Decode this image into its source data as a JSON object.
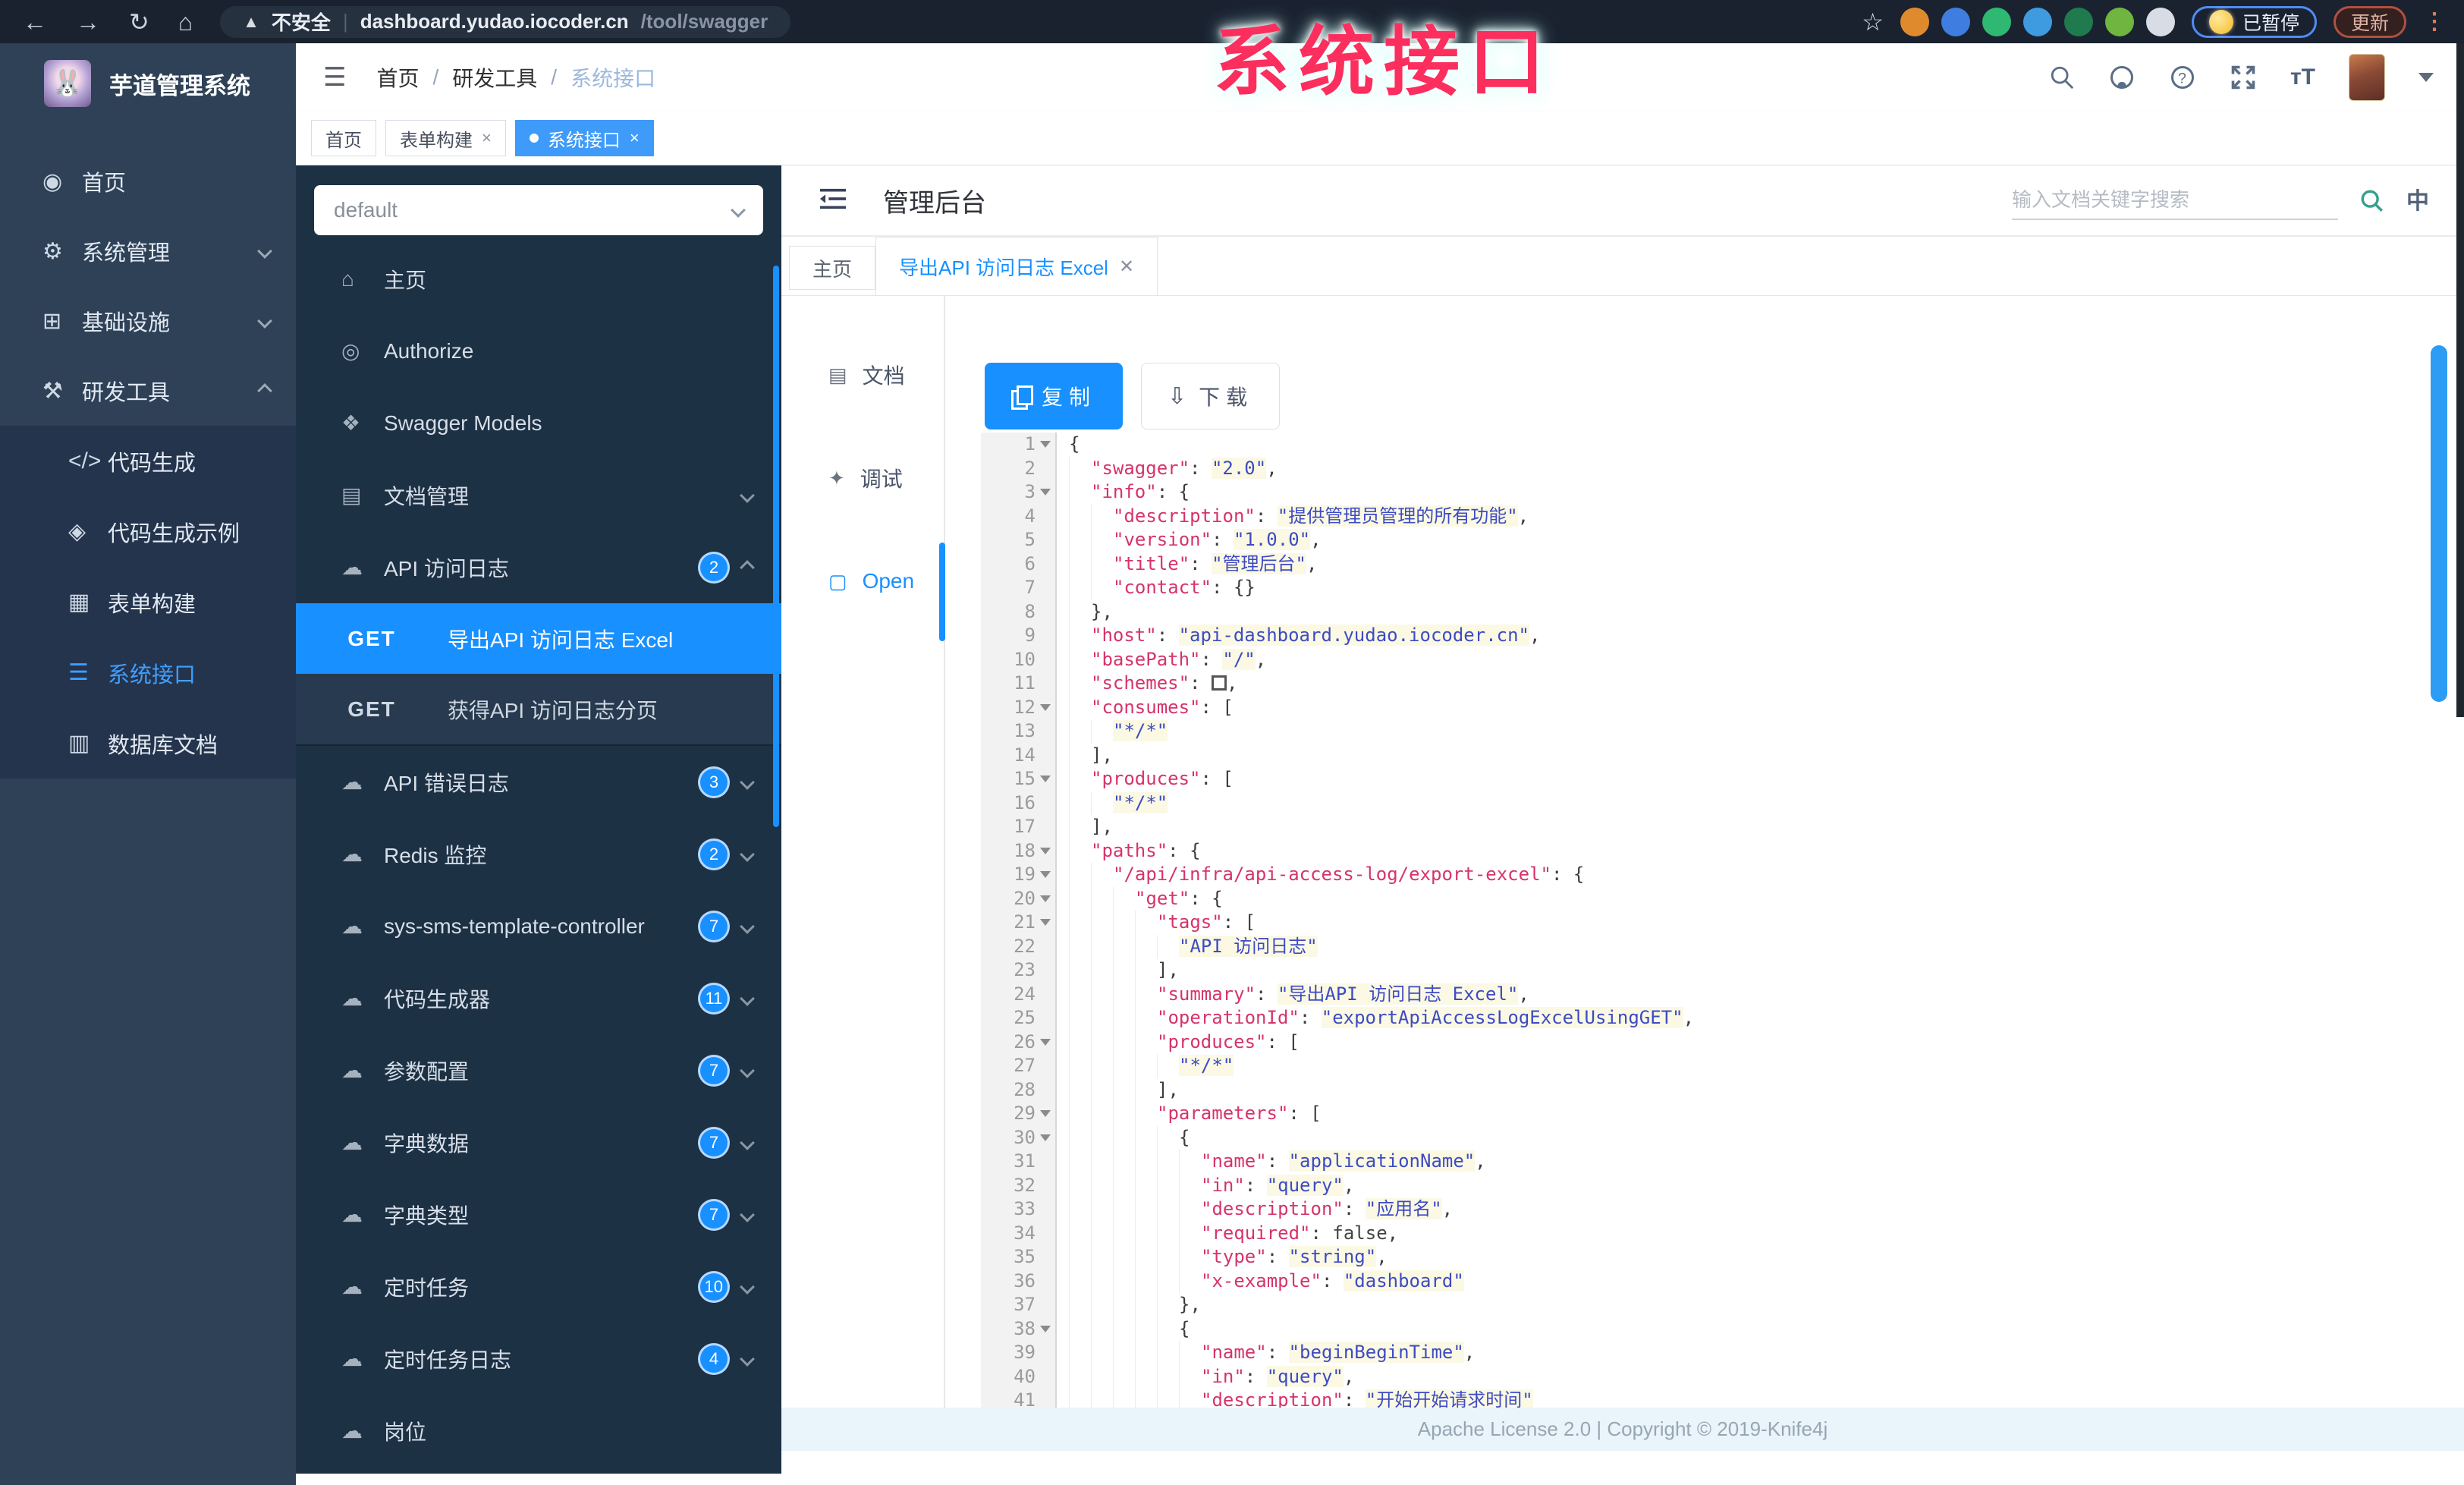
{
  "browser": {
    "back_icon": "←",
    "forward_icon": "→",
    "reload_icon": "↻",
    "home_icon": "⌂",
    "warning_icon": "▲",
    "security_label": "不安全",
    "url_host": "dashboard.yudao.iocoder.cn",
    "url_path": "/tool/swagger",
    "star_icon": "☆",
    "paused_label": "已暂停",
    "update_label": "更新",
    "menu_icon": "⋮",
    "extension_colors": [
      "#e08a2e",
      "#3f7de0",
      "#2eb872",
      "#3f9be0",
      "#1f7a4d",
      "#6fb53f",
      "#d8dde5"
    ]
  },
  "watermark": "系统接口",
  "sidebar": {
    "logo_title": "芋道管理系统",
    "logo_glyph": "🐰",
    "items": [
      {
        "id": "home",
        "icon": "dashboard-icon",
        "glyph": "◉",
        "label": "首页",
        "chevron": ""
      },
      {
        "id": "system",
        "icon": "gear-icon",
        "glyph": "⚙",
        "label": "系统管理",
        "chevron": "down"
      },
      {
        "id": "infra",
        "icon": "infra-icon",
        "glyph": "⊞",
        "label": "基础设施",
        "chevron": "down"
      },
      {
        "id": "devtools",
        "icon": "toolbox-icon",
        "glyph": "⚒",
        "label": "研发工具",
        "chevron": "up"
      }
    ],
    "sub_items": [
      {
        "id": "codegen",
        "icon": "code-icon",
        "glyph": "</>",
        "label": "代码生成",
        "active": false
      },
      {
        "id": "codegen-demo",
        "icon": "shield-check-icon",
        "glyph": "◈",
        "label": "代码生成示例",
        "active": false
      },
      {
        "id": "form-builder",
        "icon": "form-icon",
        "glyph": "▦",
        "label": "表单构建",
        "active": false
      },
      {
        "id": "system-api",
        "icon": "list-icon",
        "glyph": "☰",
        "label": "系统接口",
        "active": true
      },
      {
        "id": "db-doc",
        "icon": "table-icon",
        "glyph": "▥",
        "label": "数据库文档",
        "active": false
      }
    ]
  },
  "header": {
    "hamburger_icon": "☰",
    "breadcrumb": [
      "首页",
      "研发工具",
      "系统接口"
    ],
    "text_size_label": "тT"
  },
  "tags": [
    {
      "label": "首页",
      "closable": false,
      "active": false
    },
    {
      "label": "表单构建",
      "closable": true,
      "active": false
    },
    {
      "label": "系统接口",
      "closable": true,
      "active": true
    }
  ],
  "swagger_sidebar": {
    "group_select_value": "default",
    "items": [
      {
        "icon": "home-icon",
        "glyph": "⌂",
        "label": "主页",
        "badge": "",
        "chevron": ""
      },
      {
        "icon": "lock-icon",
        "glyph": "◎",
        "label": "Authorize",
        "badge": "",
        "chevron": ""
      },
      {
        "icon": "models-icon",
        "glyph": "❖",
        "label": "Swagger Models",
        "badge": "",
        "chevron": ""
      },
      {
        "icon": "doc-manage-icon",
        "glyph": "▤",
        "label": "文档管理",
        "badge": "",
        "chevron": "down"
      },
      {
        "icon": "api-cloud-icon",
        "glyph": "☁",
        "label": "API 访问日志",
        "badge": "2",
        "chevron": "up"
      }
    ],
    "get_items": [
      {
        "method": "GET",
        "label": "导出API 访问日志 Excel",
        "active": true
      },
      {
        "method": "GET",
        "label": "获得API 访问日志分页",
        "active": false
      }
    ],
    "items_after": [
      {
        "icon": "api-cloud-icon",
        "glyph": "☁",
        "label": "API 错误日志",
        "badge": "3",
        "chevron": "down"
      },
      {
        "icon": "api-cloud-icon",
        "glyph": "☁",
        "label": "Redis 监控",
        "badge": "2",
        "chevron": "down"
      },
      {
        "icon": "api-cloud-icon",
        "glyph": "☁",
        "label": "sys-sms-template-controller",
        "badge": "7",
        "chevron": "down"
      },
      {
        "icon": "api-cloud-icon",
        "glyph": "☁",
        "label": "代码生成器",
        "badge": "11",
        "chevron": "down"
      },
      {
        "icon": "api-cloud-icon",
        "glyph": "☁",
        "label": "参数配置",
        "badge": "7",
        "chevron": "down"
      },
      {
        "icon": "api-cloud-icon",
        "glyph": "☁",
        "label": "字典数据",
        "badge": "7",
        "chevron": "down"
      },
      {
        "icon": "api-cloud-icon",
        "glyph": "☁",
        "label": "字典类型",
        "badge": "7",
        "chevron": "down"
      },
      {
        "icon": "api-cloud-icon",
        "glyph": "☁",
        "label": "定时任务",
        "badge": "10",
        "chevron": "down"
      },
      {
        "icon": "api-cloud-icon",
        "glyph": "☁",
        "label": "定时任务日志",
        "badge": "4",
        "chevron": "down"
      },
      {
        "icon": "api-cloud-icon",
        "glyph": "☁",
        "label": "岗位",
        "badge": "",
        "chevron": ""
      }
    ]
  },
  "doc": {
    "title": "管理后台",
    "search_placeholder": "输入文档关键字搜索",
    "lang_label": "中",
    "tabs": [
      {
        "label": "主页",
        "closable": false,
        "active": false
      },
      {
        "label": "导出API 访问日志 Excel",
        "closable": true,
        "active": true
      }
    ],
    "rail": [
      {
        "icon": "document-icon",
        "glyph": "▤",
        "label": "文档",
        "active": false
      },
      {
        "icon": "debug-bug-icon",
        "glyph": "✦",
        "label": "调试",
        "active": false
      },
      {
        "icon": "open-file-icon",
        "glyph": "▢",
        "label": "Open",
        "active": true
      }
    ],
    "copy_label": "复制",
    "download_label": "下载",
    "download_icon": "⇩"
  },
  "code": {
    "lines": [
      {
        "n": 1,
        "ind": 0,
        "fold": true,
        "raw": "{"
      },
      {
        "n": 2,
        "ind": 1,
        "k": "swagger",
        "v": "2.0",
        "c": true
      },
      {
        "n": 3,
        "ind": 1,
        "fold": true,
        "k": "info",
        "open": "{"
      },
      {
        "n": 4,
        "ind": 2,
        "k": "description",
        "v": "提供管理员管理的所有功能",
        "c": true
      },
      {
        "n": 5,
        "ind": 2,
        "k": "version",
        "v": "1.0.0",
        "c": true
      },
      {
        "n": 6,
        "ind": 2,
        "k": "title",
        "v": "管理后台",
        "c": true
      },
      {
        "n": 7,
        "ind": 2,
        "k": "contact",
        "raw2": "{}"
      },
      {
        "n": 8,
        "ind": 1,
        "raw": "},"
      },
      {
        "n": 9,
        "ind": 1,
        "k": "host",
        "v": "api-dashboard.yudao.iocoder.cn",
        "c": true
      },
      {
        "n": 10,
        "ind": 1,
        "k": "basePath",
        "v": "/",
        "c": true
      },
      {
        "n": 11,
        "ind": 1,
        "k": "schemes",
        "box": true,
        "c": true
      },
      {
        "n": 12,
        "ind": 1,
        "fold": true,
        "k": "consumes",
        "open": "["
      },
      {
        "n": 13,
        "ind": 2,
        "v": "*/*"
      },
      {
        "n": 14,
        "ind": 1,
        "raw": "],"
      },
      {
        "n": 15,
        "ind": 1,
        "fold": true,
        "k": "produces",
        "open": "["
      },
      {
        "n": 16,
        "ind": 2,
        "v": "*/*"
      },
      {
        "n": 17,
        "ind": 1,
        "raw": "],"
      },
      {
        "n": 18,
        "ind": 1,
        "fold": true,
        "k": "paths",
        "open": "{"
      },
      {
        "n": 19,
        "ind": 2,
        "fold": true,
        "k": "/api/infra/api-access-log/export-excel",
        "open": "{"
      },
      {
        "n": 20,
        "ind": 3,
        "fold": true,
        "k": "get",
        "open": "{"
      },
      {
        "n": 21,
        "ind": 4,
        "fold": true,
        "k": "tags",
        "open": "["
      },
      {
        "n": 22,
        "ind": 5,
        "v": "API 访问日志"
      },
      {
        "n": 23,
        "ind": 4,
        "raw": "],"
      },
      {
        "n": 24,
        "ind": 4,
        "k": "summary",
        "v": "导出API 访问日志 Excel",
        "c": true
      },
      {
        "n": 25,
        "ind": 4,
        "k": "operationId",
        "v": "exportApiAccessLogExcelUsingGET",
        "c": true
      },
      {
        "n": 26,
        "ind": 4,
        "fold": true,
        "k": "produces",
        "open": "["
      },
      {
        "n": 27,
        "ind": 5,
        "v": "*/*"
      },
      {
        "n": 28,
        "ind": 4,
        "raw": "],"
      },
      {
        "n": 29,
        "ind": 4,
        "fold": true,
        "k": "parameters",
        "open": "["
      },
      {
        "n": 30,
        "ind": 5,
        "fold": true,
        "raw": "{"
      },
      {
        "n": 31,
        "ind": 6,
        "k": "name",
        "v": "applicationName",
        "c": true
      },
      {
        "n": 32,
        "ind": 6,
        "k": "in",
        "v": "query",
        "c": true
      },
      {
        "n": 33,
        "ind": 6,
        "k": "description",
        "v": "应用名",
        "c": true
      },
      {
        "n": 34,
        "ind": 6,
        "k": "required",
        "b": "false",
        "c": true
      },
      {
        "n": 35,
        "ind": 6,
        "k": "type",
        "v": "string",
        "c": true
      },
      {
        "n": 36,
        "ind": 6,
        "k": "x-example",
        "v": "dashboard"
      },
      {
        "n": 37,
        "ind": 5,
        "raw": "},"
      },
      {
        "n": 38,
        "ind": 5,
        "fold": true,
        "raw": "{"
      },
      {
        "n": 39,
        "ind": 6,
        "k": "name",
        "v": "beginBeginTime",
        "c": true
      },
      {
        "n": 40,
        "ind": 6,
        "k": "in",
        "v": "query",
        "c": true
      },
      {
        "n": 41,
        "ind": 6,
        "k": "description",
        "v": "开始开始请求时间"
      }
    ]
  },
  "footer": "Apache License 2.0 | Copyright © 2019-Knife4j"
}
